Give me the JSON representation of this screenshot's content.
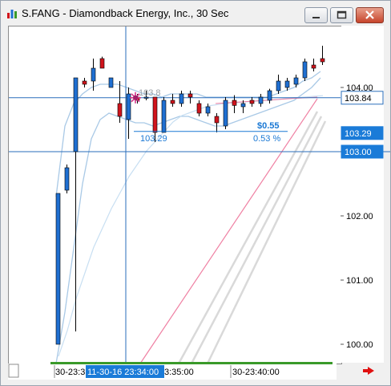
{
  "window": {
    "title": "S.FANG - Diamondback Energy, Inc., 30 Sec"
  },
  "colors": {
    "up_candle": "#1f6fd1",
    "down_candle": "#d0141c",
    "crosshair": "#2a6ebb",
    "measure": "#1a78d4",
    "band_outer": "#a9c9e6",
    "band_inner": "#c8dff2",
    "ma_pink": "#ef7fa2",
    "channel_grey": "#d9d9d9",
    "time_highlight": "#1a7bd8",
    "volume_bar": "#3a9a2a",
    "arrow_red": "#e01010"
  },
  "icons": {
    "app": "chart-bar-icon",
    "minimize": "minimize-icon",
    "maximize": "maximize-icon",
    "close": "close-icon",
    "scroll_right": "arrow-right-icon"
  },
  "price_axis": {
    "ticks": [
      "104.00",
      "103.00",
      "102.00",
      "101.00",
      "100.00"
    ],
    "markers": [
      {
        "label": "103.84",
        "value": 103.84,
        "style": "dark"
      },
      {
        "label": "103.29",
        "value": 103.29,
        "style": "blue"
      },
      {
        "label": "103.00",
        "value": 103.0,
        "style": "blue"
      }
    ]
  },
  "time_axis": {
    "left_label": "30-23:3",
    "highlight_label": "11-30-16 23:34:00",
    "after_highlight": "3:35:00",
    "right_label": "30-23:40:00"
  },
  "measure": {
    "start_price": "103.29",
    "change": "$0.55",
    "percent": "0.53 %",
    "cursor_price": "103.8"
  },
  "chart_data": {
    "type": "candlestick",
    "title": "S.FANG - Diamondback Energy, Inc., 30 Sec",
    "ylim": [
      99.8,
      105.0
    ],
    "grid": false,
    "candles": [
      {
        "open": 100.0,
        "high": 102.35,
        "low": 100.0,
        "close": 102.35,
        "dir": "up"
      },
      {
        "open": 102.4,
        "high": 102.8,
        "low": 102.35,
        "close": 102.75,
        "dir": "up"
      },
      {
        "open": 103.0,
        "high": 104.15,
        "low": 100.2,
        "close": 104.15,
        "dir": "up"
      },
      {
        "open": 104.1,
        "high": 104.15,
        "low": 104.0,
        "close": 104.05,
        "dir": "down"
      },
      {
        "open": 104.1,
        "high": 104.45,
        "low": 103.95,
        "close": 104.3,
        "dir": "up"
      },
      {
        "open": 104.45,
        "high": 104.48,
        "low": 104.3,
        "close": 104.3,
        "dir": "down"
      },
      {
        "open": 104.15,
        "high": 104.15,
        "low": 104.0,
        "close": 104.0,
        "dir": "up"
      },
      {
        "open": 103.75,
        "high": 104.1,
        "low": 103.45,
        "close": 103.55,
        "dir": "down"
      },
      {
        "open": 103.5,
        "high": 104.0,
        "low": 103.2,
        "close": 103.9,
        "dir": "up"
      },
      {
        "open": 103.85,
        "high": 103.9,
        "low": 103.75,
        "close": 103.8,
        "dir": "down"
      },
      {
        "open": 103.85,
        "high": 103.95,
        "low": 103.8,
        "close": 103.85,
        "dir": "up"
      },
      {
        "open": 103.85,
        "high": 103.85,
        "low": 103.15,
        "close": 103.3,
        "dir": "down"
      },
      {
        "open": 103.3,
        "high": 103.85,
        "low": 103.3,
        "close": 103.8,
        "dir": "up"
      },
      {
        "open": 103.8,
        "high": 103.9,
        "low": 103.7,
        "close": 103.75,
        "dir": "down"
      },
      {
        "open": 103.75,
        "high": 103.95,
        "low": 103.7,
        "close": 103.9,
        "dir": "up"
      },
      {
        "open": 103.9,
        "high": 103.95,
        "low": 103.75,
        "close": 103.85,
        "dir": "down"
      },
      {
        "open": 103.75,
        "high": 103.8,
        "low": 103.55,
        "close": 103.6,
        "dir": "down"
      },
      {
        "open": 103.6,
        "high": 103.75,
        "low": 103.55,
        "close": 103.7,
        "dir": "up"
      },
      {
        "open": 103.55,
        "high": 103.6,
        "low": 103.3,
        "close": 103.45,
        "dir": "down"
      },
      {
        "open": 103.4,
        "high": 103.85,
        "low": 103.35,
        "close": 103.8,
        "dir": "up"
      },
      {
        "open": 103.8,
        "high": 103.88,
        "low": 103.6,
        "close": 103.72,
        "dir": "down"
      },
      {
        "open": 103.7,
        "high": 103.8,
        "low": 103.6,
        "close": 103.75,
        "dir": "up"
      },
      {
        "open": 103.8,
        "high": 103.85,
        "low": 103.7,
        "close": 103.75,
        "dir": "down"
      },
      {
        "open": 103.75,
        "high": 103.9,
        "low": 103.7,
        "close": 103.85,
        "dir": "up"
      },
      {
        "open": 103.8,
        "high": 103.98,
        "low": 103.75,
        "close": 103.95,
        "dir": "up"
      },
      {
        "open": 103.95,
        "high": 104.2,
        "low": 103.9,
        "close": 104.1,
        "dir": "up"
      },
      {
        "open": 104.0,
        "high": 104.15,
        "low": 103.95,
        "close": 104.1,
        "dir": "up"
      },
      {
        "open": 104.05,
        "high": 104.2,
        "low": 104.0,
        "close": 104.15,
        "dir": "up"
      },
      {
        "open": 104.15,
        "high": 104.45,
        "low": 104.1,
        "close": 104.4,
        "dir": "up"
      },
      {
        "open": 104.35,
        "high": 104.45,
        "low": 104.25,
        "close": 104.3,
        "dir": "down"
      },
      {
        "open": 104.45,
        "high": 104.65,
        "low": 104.35,
        "close": 104.4,
        "dir": "down"
      }
    ],
    "band_upper": [
      102.3,
      103.4,
      103.75,
      103.9,
      104.0,
      104.05,
      104.05,
      104.05,
      104.0,
      103.95,
      103.9,
      103.9,
      103.85,
      103.9,
      103.9,
      103.9,
      103.9,
      103.85,
      103.85,
      103.85,
      103.85,
      103.85,
      103.85,
      103.85,
      103.85,
      103.9,
      103.95,
      104.0,
      104.1,
      104.15,
      104.25
    ],
    "band_lower": [
      99.7,
      100.5,
      101.5,
      102.5,
      103.2,
      103.5,
      103.6,
      103.55,
      103.5,
      103.45,
      103.45,
      103.4,
      103.45,
      103.5,
      103.55,
      103.55,
      103.5,
      103.45,
      103.4,
      103.4,
      103.45,
      103.5,
      103.55,
      103.6,
      103.65,
      103.7,
      103.75,
      103.8,
      103.9,
      104.0,
      104.15
    ],
    "moving_average": [
      99.8,
      100.2,
      100.7,
      101.1,
      101.5,
      101.8,
      102.1,
      102.35,
      102.6,
      102.8,
      103.0,
      103.15,
      103.3,
      103.45,
      103.55,
      103.6,
      103.65,
      103.7,
      103.72,
      103.74,
      103.75,
      103.76,
      103.77,
      103.78,
      103.79,
      103.8,
      103.82,
      103.83,
      103.84,
      103.85,
      103.86
    ]
  }
}
